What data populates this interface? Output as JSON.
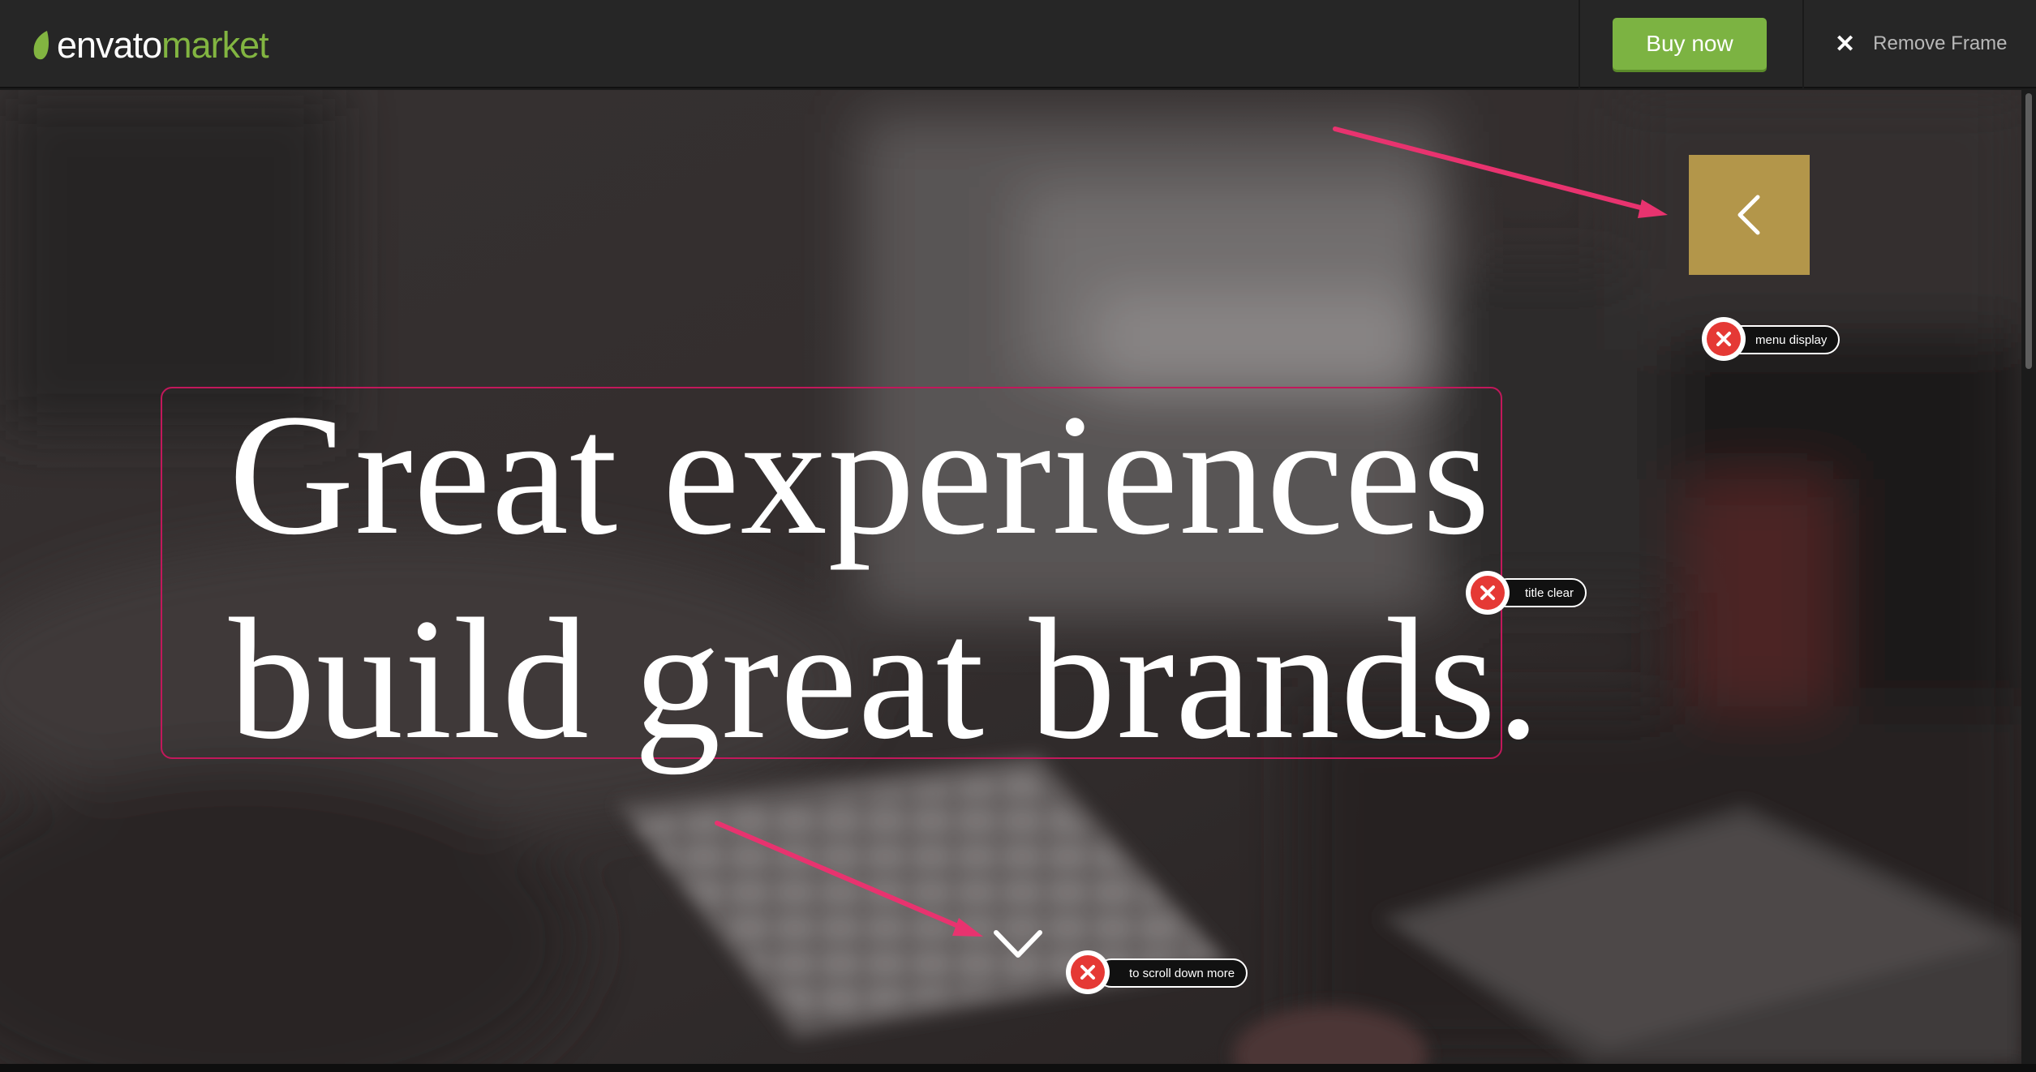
{
  "header": {
    "logo_word1": "envato",
    "logo_word2": "market",
    "buy_label": "Buy now",
    "remove_label": "Remove Frame"
  },
  "hero": {
    "headline_line1": "Great experiences",
    "headline_line2": "build great brands."
  },
  "annotations": {
    "menu_note": "menu display",
    "title_note": "title clear",
    "scroll_note": "to  scroll down more"
  },
  "colors": {
    "topbar": "#262626",
    "brand_green": "#82b541",
    "buy_button": "#7cb342",
    "menu_button": "#b3964a",
    "annotation_pink": "#e8336f",
    "annotation_red": "#e53935"
  },
  "icons": {
    "menu_button": "chevron-left-icon",
    "scroll_down": "chevron-down-icon",
    "remove_frame": "close-icon",
    "annotation": "close-circle-icon"
  }
}
